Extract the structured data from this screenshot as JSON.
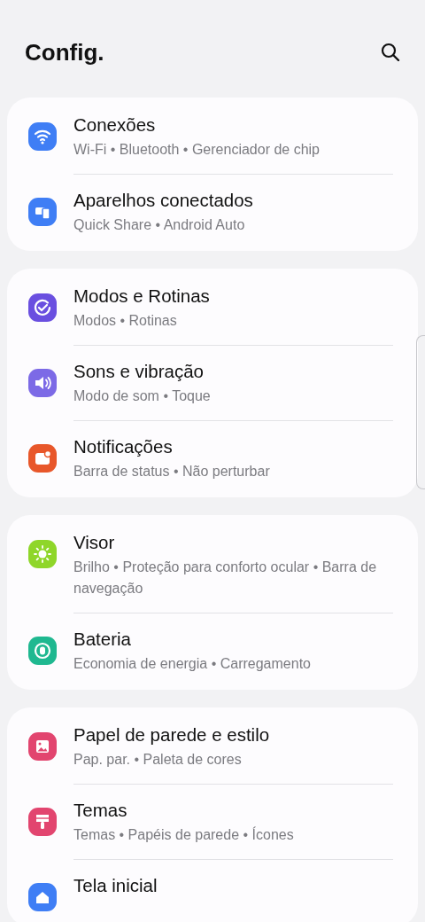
{
  "header": {
    "title": "Config."
  },
  "groups": [
    {
      "items": [
        {
          "title": "Conexões",
          "subtitle": "Wi-Fi • Bluetooth • Gerenciador de chip",
          "color": "#3f7ef5"
        },
        {
          "title": "Aparelhos conectados",
          "subtitle": "Quick Share • Android Auto",
          "color": "#3f7ef5"
        }
      ]
    },
    {
      "items": [
        {
          "title": "Modos e Rotinas",
          "subtitle": "Modos • Rotinas",
          "color": "#6a4fe0"
        },
        {
          "title": "Sons e vibração",
          "subtitle": "Modo de som • Toque",
          "color": "#7c6ae6"
        },
        {
          "title": "Notificações",
          "subtitle": "Barra de status • Não perturbar",
          "color": "#e8572a"
        }
      ]
    },
    {
      "items": [
        {
          "title": "Visor",
          "subtitle": "Brilho • Proteção para conforto ocular • Barra de navegação",
          "color": "#8fd62a"
        },
        {
          "title": "Bateria",
          "subtitle": "Economia de energia • Carregamento",
          "color": "#1fb890"
        }
      ]
    },
    {
      "items": [
        {
          "title": "Papel de parede e estilo",
          "subtitle": "Pap. par. • Paleta de cores",
          "color": "#e2456f"
        },
        {
          "title": "Temas",
          "subtitle": "Temas • Papéis de parede • Ícones",
          "color": "#e2456f"
        },
        {
          "title": "Tela inicial",
          "color": "#3f7ef5"
        }
      ]
    }
  ]
}
